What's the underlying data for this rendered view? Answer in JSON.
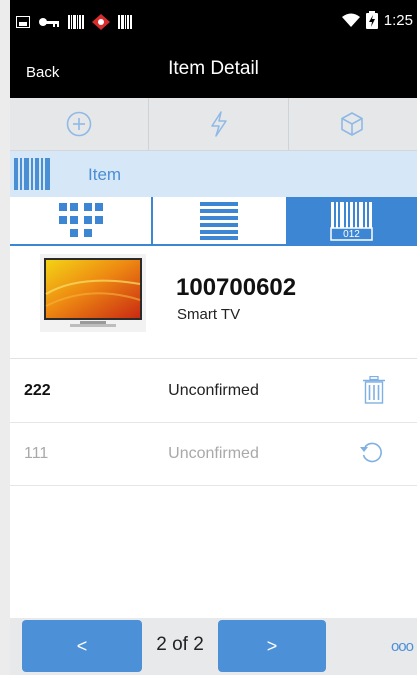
{
  "status_bar": {
    "time": "1:25"
  },
  "nav": {
    "back_label": "Back",
    "title": "Item Detail"
  },
  "actions": [
    {
      "icon": "plus-circle-icon"
    },
    {
      "icon": "lightning-icon"
    },
    {
      "icon": "cube-icon"
    }
  ],
  "item_header": {
    "label": "Item"
  },
  "tabs": [
    {
      "icon": "grid-view-icon",
      "selected": false
    },
    {
      "icon": "list-view-icon",
      "selected": false
    },
    {
      "icon": "barcode-icon",
      "barcode_text": "012",
      "selected": true
    }
  ],
  "item": {
    "id": "100700602",
    "description": "Smart TV"
  },
  "rows": [
    {
      "code": "222",
      "status": "Unconfirmed",
      "icon": "trash-icon"
    },
    {
      "code": "111",
      "status": "Unconfirmed",
      "icon": "undo-icon"
    }
  ],
  "footer": {
    "prev_label": "<",
    "next_label": ">",
    "page_indicator": "2 of 2",
    "more_label": "ooo"
  },
  "colors": {
    "accent": "#4c90d8",
    "tab_accent": "#3d86d4",
    "header_bg": "#000000",
    "item_header_bg": "#d6e8f8",
    "muted_text": "#a9a9a9"
  }
}
